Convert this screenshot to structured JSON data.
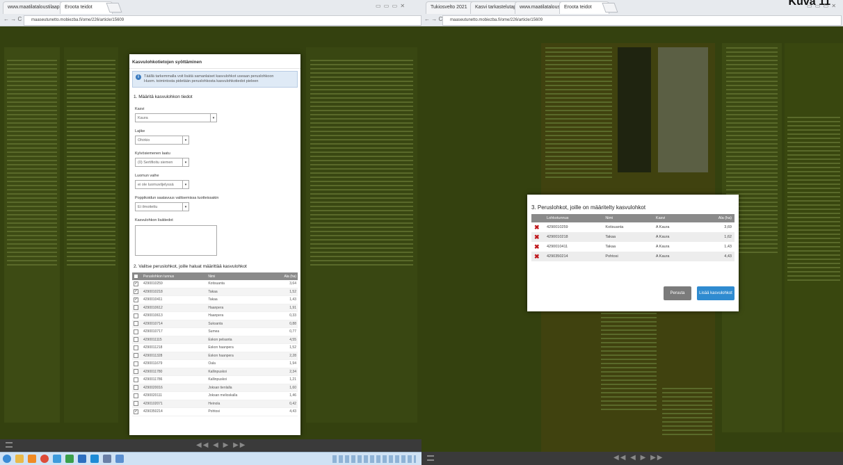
{
  "overlay_label": "Kuva 11",
  "left_window": {
    "tabs": [
      {
        "label": "www.maatilataloustilaapp"
      },
      {
        "label": "Eroota teidot"
      }
    ],
    "url": "maaseutunetto.mobiezba.fi/ome/226/article/15609",
    "modal": {
      "title": "Kasvulohkotietojen syöttäminen",
      "info_line1": "Täällä tarkemmalla voit lisätä samanlaiset kasvulohkot useaan peruslohkoon",
      "info_line2": "Huom. toimintosta pidetään peruslohkosta kasvulohkotiedot pieleen",
      "section1": "1. Määritä kasvulohkon tiedot",
      "fields": [
        {
          "label": "Kasvi",
          "value": "Kaura"
        },
        {
          "label": "Lajike",
          "value": "Ohirkio"
        },
        {
          "label": "Kylvösiemenen laatu",
          "value": "(0) Sertifioitu siemen"
        },
        {
          "label": "Luomun vaihe",
          "value": "ei ole luomuviljelyssä"
        },
        {
          "label": "Poppikoidun saatavuus valitsemissa tuotteissakin",
          "value": "Ei ilmoitettu"
        }
      ],
      "notes_label": "Kasvulohkon lisätiedot",
      "section2": "2. Valitse peruslohkot, joille haluat määrittää kasvulohkot",
      "table_headers": [
        "",
        "Peruslohkon tunnus",
        "Nimi",
        "Ala (ha)"
      ],
      "rows": [
        {
          "checked": true,
          "id": "4290010259",
          "name": "Kotisuanta",
          "ala": "3,64"
        },
        {
          "checked": true,
          "id": "4290010218",
          "name": "Takaa",
          "ala": "1,52"
        },
        {
          "checked": true,
          "id": "4290010411",
          "name": "Takaa",
          "ala": "1,43"
        },
        {
          "checked": false,
          "id": "4290010612",
          "name": "Haanpera",
          "ala": "1,91"
        },
        {
          "checked": false,
          "id": "4290010613",
          "name": "Haanpera",
          "ala": "0,33"
        },
        {
          "checked": false,
          "id": "4290010714",
          "name": "Suksanta",
          "ala": "0,88"
        },
        {
          "checked": false,
          "id": "4290010717",
          "name": "Sumea",
          "ala": "0,77"
        },
        {
          "checked": false,
          "id": "4290011115",
          "name": "Eskon pelsanta",
          "ala": "4,55"
        },
        {
          "checked": false,
          "id": "4290011218",
          "name": "Eskon haanpera",
          "ala": "1,52"
        },
        {
          "checked": false,
          "id": "4290011328",
          "name": "Eskon haanpera",
          "ala": "2,28"
        },
        {
          "checked": false,
          "id": "4290011679",
          "name": "Oala",
          "ala": "1,94"
        },
        {
          "checked": false,
          "id": "4290011780",
          "name": "Kallinpuskoi",
          "ala": "2,34"
        },
        {
          "checked": false,
          "id": "4290011786",
          "name": "Kallinpuskoi",
          "ala": "1,21"
        },
        {
          "checked": false,
          "id": "4290020016",
          "name": "Joksan tienlalla",
          "ala": "1,60"
        },
        {
          "checked": false,
          "id": "4290020111",
          "name": "Joksan melioskalla",
          "ala": "1,46"
        },
        {
          "checked": false,
          "id": "4290102071",
          "name": "Heinola",
          "ala": "0,42"
        },
        {
          "checked": true,
          "id": "4290350214",
          "name": "Pohtosi",
          "ala": "4,43"
        }
      ]
    }
  },
  "right_window": {
    "tabs": [
      {
        "label": "Tukiosvelto 2021"
      },
      {
        "label": "Kasvi tarkastelutapa"
      },
      {
        "label": "www.maatilataloustilaapp"
      },
      {
        "label": "Eroota teidot"
      }
    ],
    "url": "maaseutunetto.mobiezba.fi/ome/226/article/15609",
    "modal": {
      "title": "3. Peruslohkot, joille on määritelty kasvulohkot",
      "table_headers": [
        "",
        "Lohkotunnus",
        "Nimi",
        "Kasvi",
        "Ala (ha)"
      ],
      "rows": [
        {
          "id": "4290010259",
          "name": "Kotisuanta",
          "crop": "A Kaura",
          "ala": "3,69"
        },
        {
          "id": "4290010218",
          "name": "Takaa",
          "crop": "A Kaura",
          "ala": "1,62"
        },
        {
          "id": "4290010411",
          "name": "Takaa",
          "crop": "A Kaura",
          "ala": "1,43"
        },
        {
          "id": "4290350214",
          "name": "Pohtosi",
          "crop": "A Kaura",
          "ala": "4,43"
        }
      ],
      "cancel_label": "Peruuta",
      "add_label": "Lisää kasvulohkot"
    }
  },
  "pager": "◀◀  ◀  ▶  ▶▶",
  "colors": {
    "accent": "#2f8bd0",
    "delete": "#c0161b",
    "backdrop": "#34410f"
  }
}
